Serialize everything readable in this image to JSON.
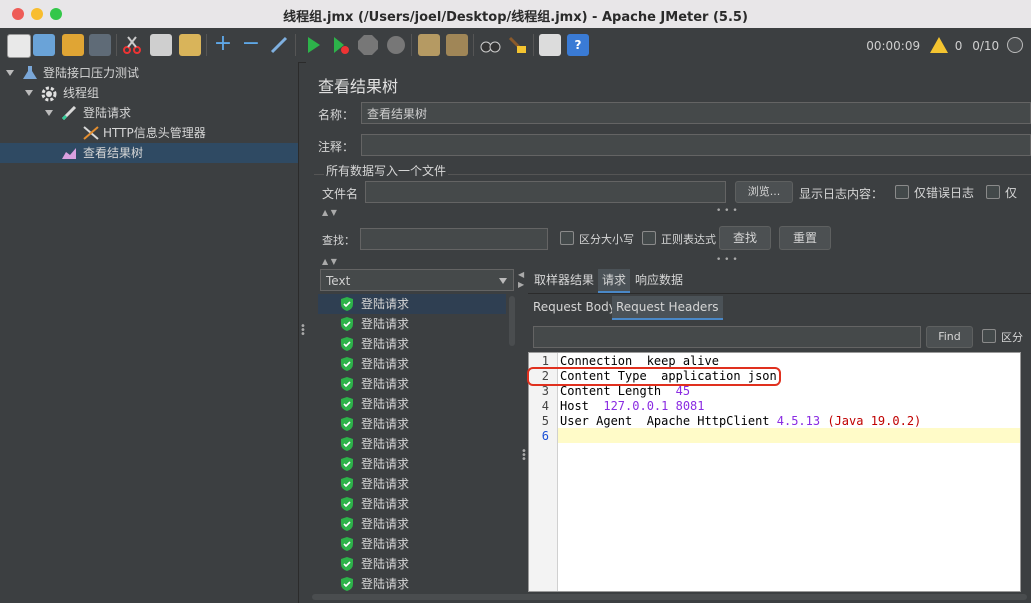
{
  "window": {
    "title": "线程组.jmx (/Users/joel/Desktop/线程组.jmx) - Apache JMeter (5.5)",
    "close_color": "#ee5c57",
    "minimize_color": "#f8bd2e",
    "zoom_color": "#33c749"
  },
  "toolbar": {
    "timer": "00:00:09",
    "warnings": "0",
    "threads": "0/10"
  },
  "tree": {
    "items": [
      {
        "label": "登陆接口压力测试",
        "icon": "flask-icon"
      },
      {
        "label": "线程组",
        "icon": "gear-icon"
      },
      {
        "label": "登陆请求",
        "icon": "pen-icon"
      },
      {
        "label": "HTTP信息头管理器",
        "icon": "wrench-icon"
      },
      {
        "label": "查看结果树",
        "icon": "chart-icon"
      }
    ]
  },
  "panel": {
    "title": "查看结果树",
    "name_label": "名称：",
    "name_value": "查看结果树",
    "comment_label": "注释：",
    "comment_value": "",
    "file_group_label": "所有数据写入一个文件",
    "filename_label": "文件名",
    "filename_value": "",
    "browse_label": "浏览...",
    "log_label": "显示日志内容：",
    "errors_only_label": "仅错误日志",
    "success_only_label": "仅",
    "search_label": "查找：",
    "search_value": "",
    "case_label": "区分大小写",
    "regex_label": "正则表达式",
    "find_button": "查找",
    "reset_button": "重置"
  },
  "renderer": {
    "selected": "Text"
  },
  "results": {
    "items": [
      "登陆请求",
      "登陆请求",
      "登陆请求",
      "登陆请求",
      "登陆请求",
      "登陆请求",
      "登陆请求",
      "登陆请求",
      "登陆请求",
      "登陆请求",
      "登陆请求",
      "登陆请求",
      "登陆请求",
      "登陆请求",
      "登陆请求"
    ]
  },
  "tabs": {
    "main": [
      "取样器结果",
      "请求",
      "响应数据"
    ],
    "sub": [
      "Request Body",
      "Request Headers"
    ]
  },
  "detail_search": {
    "value": "",
    "find_label": "Find",
    "case_label": "区分"
  },
  "editor": {
    "line_numbers": [
      "1",
      "2",
      "3",
      "4",
      "5",
      "6"
    ],
    "lines": [
      {
        "key": "Connection  keep alive",
        "val": "",
        "extra": ""
      },
      {
        "key": "Content Type  application json",
        "val": "",
        "extra": ""
      },
      {
        "key": "Content Length  ",
        "val": "45",
        "extra": ""
      },
      {
        "key": "Host  ",
        "val": "127.0.0.1 8081",
        "extra": ""
      },
      {
        "key": "User Agent  Apache HttpClient ",
        "val": "4.5.13",
        "extra": "(Java 19.0.2)"
      },
      {
        "key": "",
        "val": "",
        "extra": ""
      }
    ]
  }
}
